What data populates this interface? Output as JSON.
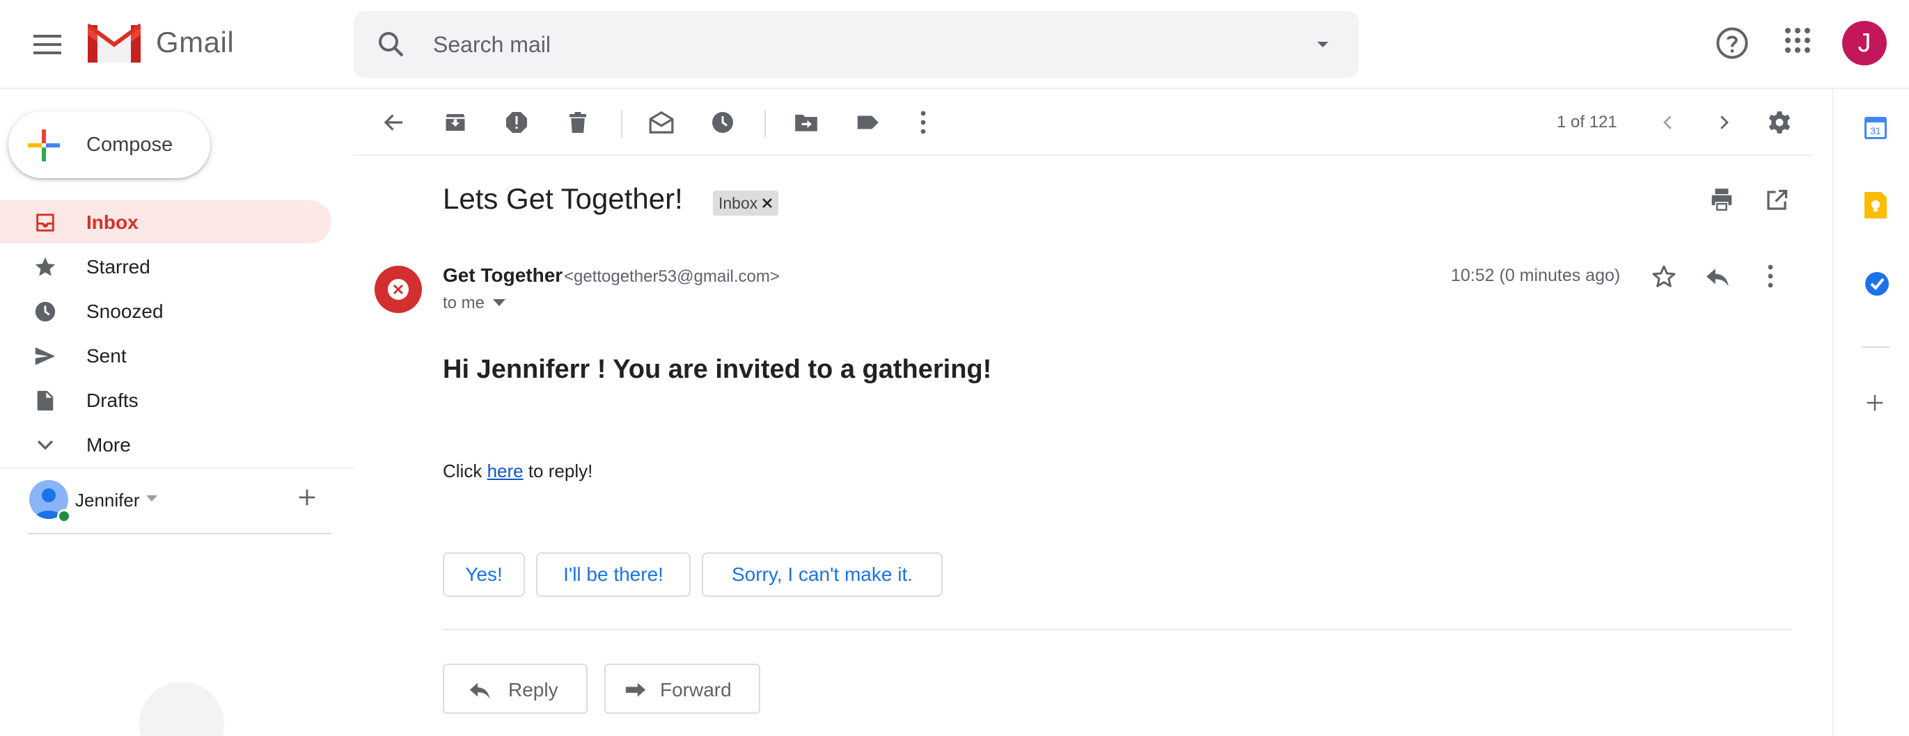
{
  "app": {
    "name": "Gmail",
    "user_initial": "J",
    "accent_color": "#d93025"
  },
  "search": {
    "placeholder": "Search mail"
  },
  "compose": {
    "label": "Compose"
  },
  "nav": {
    "items": [
      {
        "label": "Inbox",
        "icon": "inbox-icon",
        "active": true
      },
      {
        "label": "Starred",
        "icon": "star-icon"
      },
      {
        "label": "Snoozed",
        "icon": "clock-icon"
      },
      {
        "label": "Sent",
        "icon": "send-icon"
      },
      {
        "label": "Drafts",
        "icon": "draft-icon"
      },
      {
        "label": "More",
        "icon": "chevron-down-icon"
      }
    ]
  },
  "hangouts": {
    "user_name": "Jennifer"
  },
  "toolbar": {
    "page_count": "1 of 121"
  },
  "message": {
    "subject": "Lets Get Together!",
    "label_chip": "Inbox",
    "sender_name": "Get Together",
    "sender_email": "<gettogether53@gmail.com>",
    "recipient": "to me",
    "timestamp": "10:52 (0 minutes ago)",
    "greeting": "Hi Jenniferr ! You are invited to a gathering!",
    "click_prefix": "Click ",
    "click_link": "here",
    "click_suffix": " to reply!"
  },
  "smart_replies": [
    "Yes!",
    "I'll be there!",
    "Sorry, I can't make it."
  ],
  "actions": {
    "reply": "Reply",
    "forward": "Forward"
  }
}
